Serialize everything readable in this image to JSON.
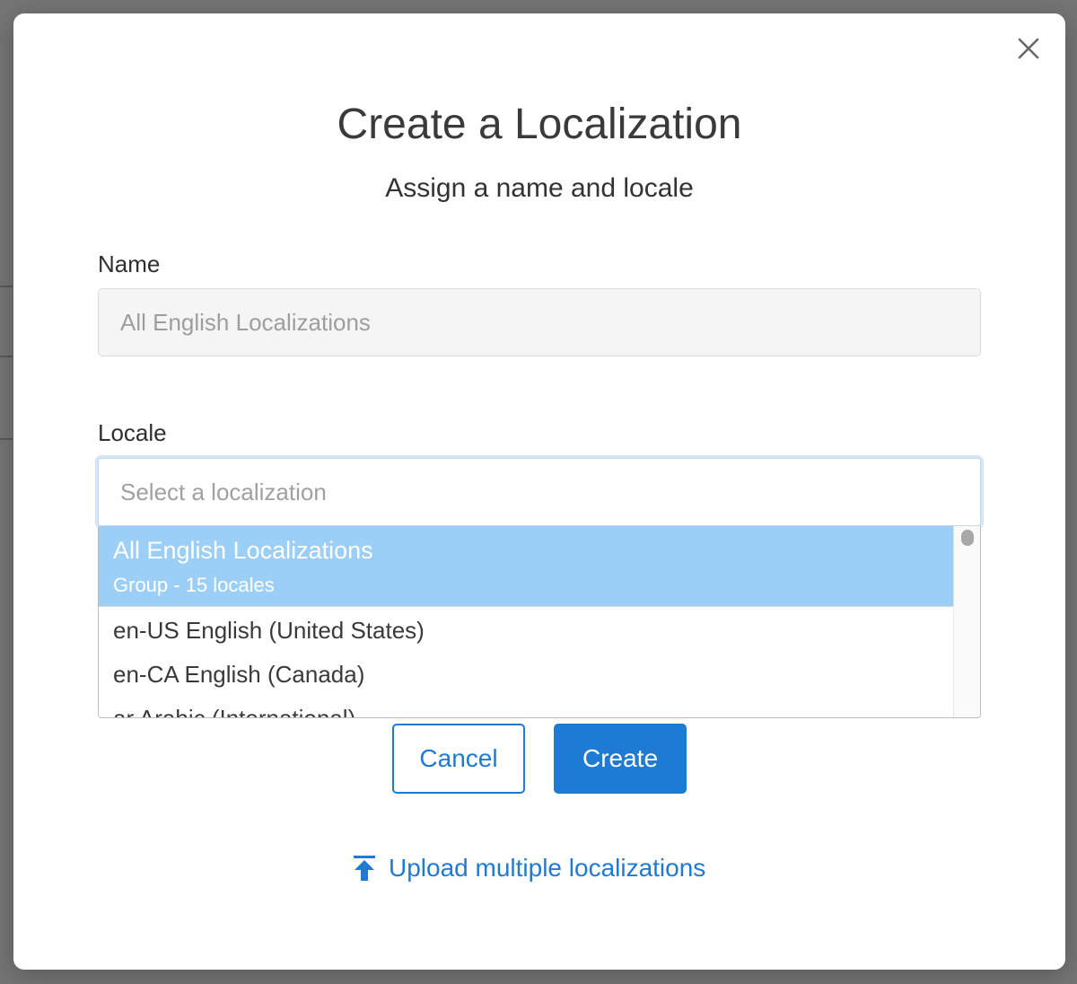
{
  "modal": {
    "title": "Create a Localization",
    "subtitle": "Assign a name and locale",
    "close_icon": "close-icon"
  },
  "form": {
    "name_label": "Name",
    "name_value": "All English Localizations",
    "locale_label": "Locale",
    "locale_placeholder": "Select a localization"
  },
  "dropdown": {
    "group": {
      "title": "All English Localizations",
      "subtitle": "Group - 15 locales"
    },
    "items": [
      "en-US English (United States)",
      "en-CA English (Canada)",
      "ar Arabic (International)"
    ]
  },
  "buttons": {
    "cancel": "Cancel",
    "create": "Create"
  },
  "upload": {
    "label": "Upload multiple localizations",
    "icon": "upload-icon"
  },
  "colors": {
    "accent": "#1f7ad4",
    "selected_option": "#9ccff8"
  }
}
